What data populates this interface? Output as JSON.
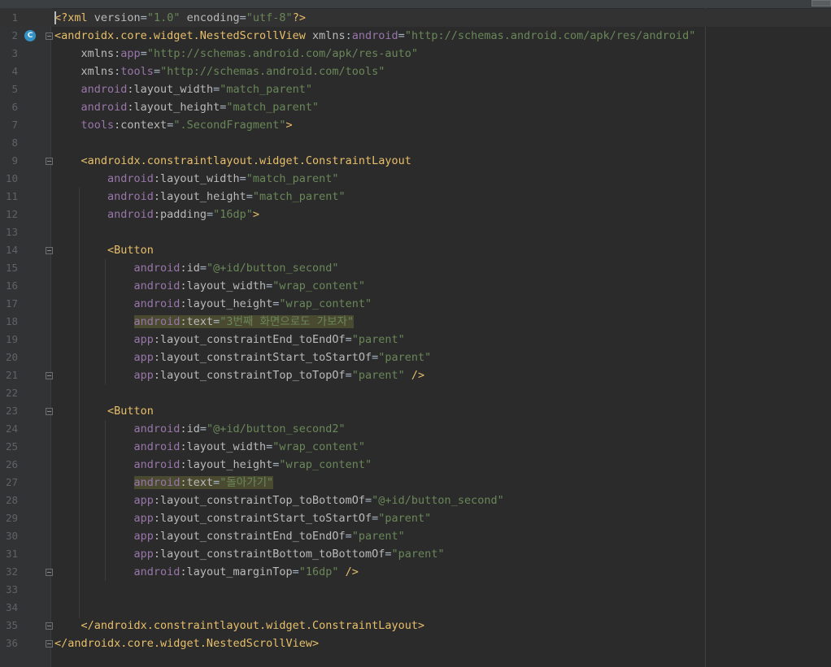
{
  "editor": {
    "lines": [
      {
        "n": "1",
        "parts": [
          {
            "t": "<?xml ",
            "c": "t-tag"
          },
          {
            "t": "version",
            "c": "t-att"
          },
          {
            "t": "=",
            "c": "t-plain"
          },
          {
            "t": "\"1.0\"",
            "c": "t-val"
          },
          {
            "t": " ",
            "c": "t-plain"
          },
          {
            "t": "encoding",
            "c": "t-att"
          },
          {
            "t": "=",
            "c": "t-plain"
          },
          {
            "t": "\"utf-8\"",
            "c": "t-val"
          },
          {
            "t": "?>",
            "c": "t-tag"
          }
        ]
      },
      {
        "n": "2",
        "parts": [
          {
            "t": "<androidx.core.widget.NestedScrollView ",
            "c": "t-tag"
          },
          {
            "t": "xmlns",
            "c": "t-att"
          },
          {
            "t": ":",
            "c": "t-plain"
          },
          {
            "t": "android",
            "c": "t-ns"
          },
          {
            "t": "=",
            "c": "t-plain"
          },
          {
            "t": "\"http://schemas.android.com/apk/res/android\"",
            "c": "t-val"
          }
        ]
      },
      {
        "n": "3",
        "parts": [
          {
            "t": "    xmlns",
            "c": "t-att"
          },
          {
            "t": ":",
            "c": "t-plain"
          },
          {
            "t": "app",
            "c": "t-ns"
          },
          {
            "t": "=",
            "c": "t-plain"
          },
          {
            "t": "\"http://schemas.android.com/apk/res-auto\"",
            "c": "t-val"
          }
        ]
      },
      {
        "n": "4",
        "parts": [
          {
            "t": "    xmlns",
            "c": "t-att"
          },
          {
            "t": ":",
            "c": "t-plain"
          },
          {
            "t": "tools",
            "c": "t-ns"
          },
          {
            "t": "=",
            "c": "t-plain"
          },
          {
            "t": "\"http://schemas.android.com/tools\"",
            "c": "t-val"
          }
        ]
      },
      {
        "n": "5",
        "parts": [
          {
            "t": "    android",
            "c": "t-ns"
          },
          {
            "t": ":layout_width",
            "c": "t-att"
          },
          {
            "t": "=",
            "c": "t-plain"
          },
          {
            "t": "\"match_parent\"",
            "c": "t-val"
          }
        ]
      },
      {
        "n": "6",
        "parts": [
          {
            "t": "    android",
            "c": "t-ns"
          },
          {
            "t": ":layout_height",
            "c": "t-att"
          },
          {
            "t": "=",
            "c": "t-plain"
          },
          {
            "t": "\"match_parent\"",
            "c": "t-val"
          }
        ]
      },
      {
        "n": "7",
        "parts": [
          {
            "t": "    tools",
            "c": "t-ns"
          },
          {
            "t": ":context",
            "c": "t-att"
          },
          {
            "t": "=",
            "c": "t-plain"
          },
          {
            "t": "\".SecondFragment\"",
            "c": "t-val"
          },
          {
            "t": ">",
            "c": "t-tag"
          }
        ]
      },
      {
        "n": "8",
        "parts": []
      },
      {
        "n": "9",
        "parts": [
          {
            "t": "    <androidx.constraintlayout.widget.ConstraintLayout",
            "c": "t-tag"
          }
        ]
      },
      {
        "n": "10",
        "parts": [
          {
            "t": "        android",
            "c": "t-ns"
          },
          {
            "t": ":layout_width",
            "c": "t-att"
          },
          {
            "t": "=",
            "c": "t-plain"
          },
          {
            "t": "\"match_parent\"",
            "c": "t-val"
          }
        ]
      },
      {
        "n": "11",
        "parts": [
          {
            "t": "        android",
            "c": "t-ns"
          },
          {
            "t": ":layout_height",
            "c": "t-att"
          },
          {
            "t": "=",
            "c": "t-plain"
          },
          {
            "t": "\"match_parent\"",
            "c": "t-val"
          }
        ]
      },
      {
        "n": "12",
        "parts": [
          {
            "t": "        android",
            "c": "t-ns"
          },
          {
            "t": ":padding",
            "c": "t-att"
          },
          {
            "t": "=",
            "c": "t-plain"
          },
          {
            "t": "\"16dp\"",
            "c": "t-val"
          },
          {
            "t": ">",
            "c": "t-tag"
          }
        ]
      },
      {
        "n": "13",
        "parts": []
      },
      {
        "n": "14",
        "parts": [
          {
            "t": "        <Button",
            "c": "t-tag"
          }
        ]
      },
      {
        "n": "15",
        "parts": [
          {
            "t": "            android",
            "c": "t-ns"
          },
          {
            "t": ":id",
            "c": "t-att"
          },
          {
            "t": "=",
            "c": "t-plain"
          },
          {
            "t": "\"@+id/button_second\"",
            "c": "t-val"
          }
        ]
      },
      {
        "n": "16",
        "parts": [
          {
            "t": "            android",
            "c": "t-ns"
          },
          {
            "t": ":layout_width",
            "c": "t-att"
          },
          {
            "t": "=",
            "c": "t-plain"
          },
          {
            "t": "\"wrap_content\"",
            "c": "t-val"
          }
        ]
      },
      {
        "n": "17",
        "parts": [
          {
            "t": "            android",
            "c": "t-ns"
          },
          {
            "t": ":layout_height",
            "c": "t-att"
          },
          {
            "t": "=",
            "c": "t-plain"
          },
          {
            "t": "\"wrap_content\"",
            "c": "t-val"
          }
        ]
      },
      {
        "n": "18",
        "parts": [
          {
            "t": "            ",
            "c": "t-plain"
          },
          {
            "t": "android",
            "c": "t-ns hl"
          },
          {
            "t": ":text",
            "c": "t-att hl"
          },
          {
            "t": "=",
            "c": "t-plain hl"
          },
          {
            "t": "\"3번째 화면으로도 가보자\"",
            "c": "t-val hl"
          }
        ]
      },
      {
        "n": "19",
        "parts": [
          {
            "t": "            app",
            "c": "t-ns"
          },
          {
            "t": ":layout_constraintEnd_toEndOf",
            "c": "t-att"
          },
          {
            "t": "=",
            "c": "t-plain"
          },
          {
            "t": "\"parent\"",
            "c": "t-val"
          }
        ]
      },
      {
        "n": "20",
        "parts": [
          {
            "t": "            app",
            "c": "t-ns"
          },
          {
            "t": ":layout_constraintStart_toStartOf",
            "c": "t-att"
          },
          {
            "t": "=",
            "c": "t-plain"
          },
          {
            "t": "\"parent\"",
            "c": "t-val"
          }
        ]
      },
      {
        "n": "21",
        "parts": [
          {
            "t": "            app",
            "c": "t-ns"
          },
          {
            "t": ":layout_constraintTop_toTopOf",
            "c": "t-att"
          },
          {
            "t": "=",
            "c": "t-plain"
          },
          {
            "t": "\"parent\"",
            "c": "t-val"
          },
          {
            "t": " />",
            "c": "t-tag"
          }
        ]
      },
      {
        "n": "22",
        "parts": []
      },
      {
        "n": "23",
        "parts": [
          {
            "t": "        <Button",
            "c": "t-tag"
          }
        ]
      },
      {
        "n": "24",
        "parts": [
          {
            "t": "            android",
            "c": "t-ns"
          },
          {
            "t": ":id",
            "c": "t-att"
          },
          {
            "t": "=",
            "c": "t-plain"
          },
          {
            "t": "\"@+id/button_second2\"",
            "c": "t-val"
          }
        ]
      },
      {
        "n": "25",
        "parts": [
          {
            "t": "            android",
            "c": "t-ns"
          },
          {
            "t": ":layout_width",
            "c": "t-att"
          },
          {
            "t": "=",
            "c": "t-plain"
          },
          {
            "t": "\"wrap_content\"",
            "c": "t-val"
          }
        ]
      },
      {
        "n": "26",
        "parts": [
          {
            "t": "            android",
            "c": "t-ns"
          },
          {
            "t": ":layout_height",
            "c": "t-att"
          },
          {
            "t": "=",
            "c": "t-plain"
          },
          {
            "t": "\"wrap_content\"",
            "c": "t-val"
          }
        ]
      },
      {
        "n": "27",
        "parts": [
          {
            "t": "            ",
            "c": "t-plain"
          },
          {
            "t": "android",
            "c": "t-ns hl"
          },
          {
            "t": ":text",
            "c": "t-att hl"
          },
          {
            "t": "=",
            "c": "t-plain hl"
          },
          {
            "t": "\"돌아가기\"",
            "c": "t-val hl"
          }
        ]
      },
      {
        "n": "28",
        "parts": [
          {
            "t": "            app",
            "c": "t-ns"
          },
          {
            "t": ":layout_constraintTop_toBottomOf",
            "c": "t-att"
          },
          {
            "t": "=",
            "c": "t-plain"
          },
          {
            "t": "\"@+id/button_second\"",
            "c": "t-val"
          }
        ]
      },
      {
        "n": "29",
        "parts": [
          {
            "t": "            app",
            "c": "t-ns"
          },
          {
            "t": ":layout_constraintStart_toStartOf",
            "c": "t-att"
          },
          {
            "t": "=",
            "c": "t-plain"
          },
          {
            "t": "\"parent\"",
            "c": "t-val"
          }
        ]
      },
      {
        "n": "30",
        "parts": [
          {
            "t": "            app",
            "c": "t-ns"
          },
          {
            "t": ":layout_constraintEnd_toEndOf",
            "c": "t-att"
          },
          {
            "t": "=",
            "c": "t-plain"
          },
          {
            "t": "\"parent\"",
            "c": "t-val"
          }
        ]
      },
      {
        "n": "31",
        "parts": [
          {
            "t": "            app",
            "c": "t-ns"
          },
          {
            "t": ":layout_constraintBottom_toBottomOf",
            "c": "t-att"
          },
          {
            "t": "=",
            "c": "t-plain"
          },
          {
            "t": "\"parent\"",
            "c": "t-val"
          }
        ]
      },
      {
        "n": "32",
        "parts": [
          {
            "t": "            android",
            "c": "t-ns"
          },
          {
            "t": ":layout_marginTop",
            "c": "t-att"
          },
          {
            "t": "=",
            "c": "t-plain"
          },
          {
            "t": "\"16dp\"",
            "c": "t-val"
          },
          {
            "t": " />",
            "c": "t-tag"
          }
        ]
      },
      {
        "n": "33",
        "parts": []
      },
      {
        "n": "34",
        "parts": []
      },
      {
        "n": "35",
        "parts": [
          {
            "t": "    </androidx.constraintlayout.widget.ConstraintLayout>",
            "c": "t-tag"
          }
        ]
      },
      {
        "n": "36",
        "parts": [
          {
            "t": "</androidx.core.widget.NestedScrollView>",
            "c": "t-tag"
          }
        ]
      }
    ],
    "gutter_badge": "C",
    "fold_lines": [
      "2",
      "9",
      "14",
      "21",
      "23",
      "32",
      "35",
      "36"
    ],
    "current_line": "1"
  },
  "colors": {
    "background": "#2b2b2b",
    "gutter": "#313335",
    "tag": "#e8bf6a",
    "namespace": "#9876aa",
    "attribute": "#bababa",
    "value": "#6a8759",
    "highlight": "#4a4a31"
  }
}
